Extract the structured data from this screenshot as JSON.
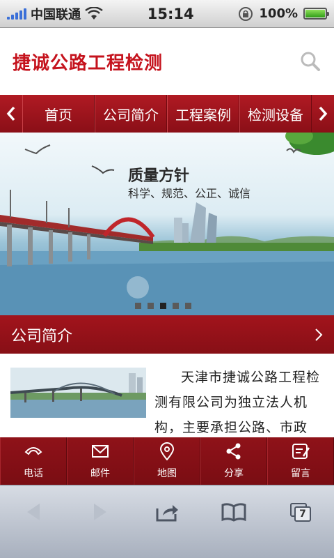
{
  "status": {
    "carrier": "中国联通",
    "time": "15:14",
    "battery": "100%"
  },
  "header": {
    "logo": "捷诚公路工程检测"
  },
  "nav": {
    "items": [
      {
        "label": "首页"
      },
      {
        "label": "公司简介"
      },
      {
        "label": "工程案例"
      },
      {
        "label": "检测设备"
      }
    ]
  },
  "banner": {
    "title": "质量方针",
    "subtitle": "科学、规范、公正、诚信",
    "slides": 5,
    "active_slide": 2
  },
  "section": {
    "title": "公司简介"
  },
  "intro": {
    "text": "天津市捷诚公路工程检测有限公司为独立法人机构，主要承担公路、市政"
  },
  "toolbar": {
    "items": [
      {
        "label": "电话",
        "icon": "phone-icon"
      },
      {
        "label": "邮件",
        "icon": "mail-icon"
      },
      {
        "label": "地图",
        "icon": "map-pin-icon"
      },
      {
        "label": "分享",
        "icon": "share-icon"
      },
      {
        "label": "留言",
        "icon": "message-icon"
      }
    ]
  },
  "safari": {
    "tab_count": "7"
  },
  "colors": {
    "brand_red": "#c5131d",
    "nav_red": "#9a141c"
  }
}
